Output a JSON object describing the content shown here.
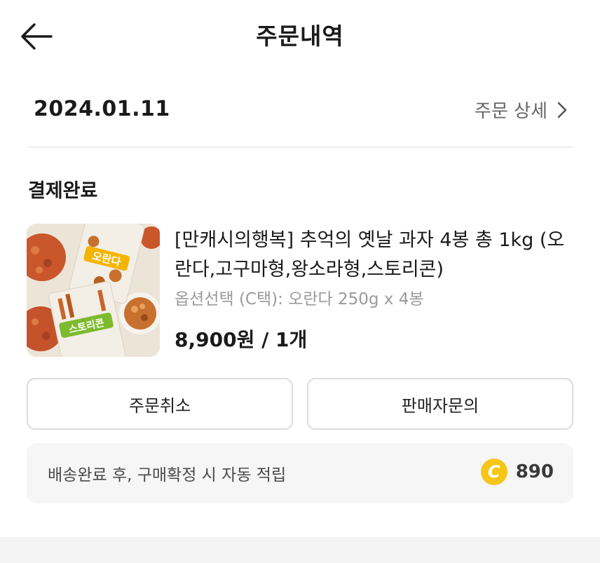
{
  "header": {
    "title": "주문내역",
    "back_icon": "arrow-left-icon"
  },
  "order": {
    "date": "2024.01.11",
    "detail_link": "주문 상세",
    "detail_icon": "chevron-right-icon",
    "status": "결제완료"
  },
  "product": {
    "name": "[만캐시의행복] 추억의 옛날 과자 4봉 총 1kg (오란다,고구마형,왕소라형,스토리콘)",
    "option": "옵션선택 (C택): 오란다 250g x 4봉",
    "price": "8,900원 / 1개",
    "thumb_labels": {
      "bag_top": "오란다",
      "bag_bottom": "스토리콘"
    }
  },
  "actions": {
    "cancel_label": "주문취소",
    "inquiry_label": "판매자문의"
  },
  "reward": {
    "text": "배송완료 후, 구매확정 시 자동 적립",
    "coin_symbol": "C",
    "points": "890",
    "coin_color": "#f5c518"
  }
}
